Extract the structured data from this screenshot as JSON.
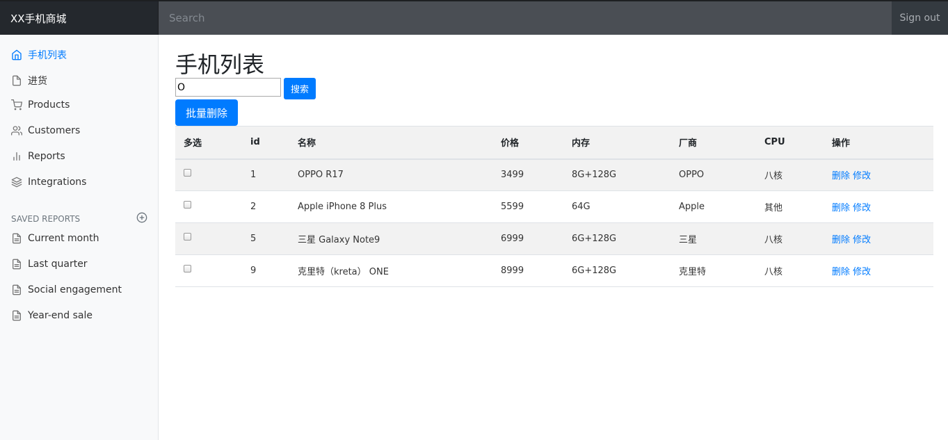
{
  "navbar": {
    "brand": "XX手机商城",
    "search_placeholder": "Search",
    "signout": "Sign out"
  },
  "sidebar": {
    "items": [
      {
        "label": "手机列表",
        "icon": "home-icon",
        "active": true
      },
      {
        "label": "进货",
        "icon": "file-icon"
      },
      {
        "label": "Products",
        "icon": "shopping-cart-icon"
      },
      {
        "label": "Customers",
        "icon": "users-icon"
      },
      {
        "label": "Reports",
        "icon": "bar-chart-icon"
      },
      {
        "label": "Integrations",
        "icon": "layers-icon"
      }
    ],
    "saved_heading": "SAVED REPORTS",
    "saved": [
      {
        "label": "Current month",
        "icon": "file-text-icon"
      },
      {
        "label": "Last quarter",
        "icon": "file-text-icon"
      },
      {
        "label": "Social engagement",
        "icon": "file-text-icon"
      },
      {
        "label": "Year-end sale",
        "icon": "file-text-icon"
      }
    ]
  },
  "main": {
    "title": "手机列表",
    "query_value": "O",
    "search_label": "搜索",
    "bulk_delete_label": "批量删除",
    "table": {
      "headers": [
        "多选",
        "id",
        "名称",
        "价格",
        "内存",
        "厂商",
        "CPU",
        "操作"
      ],
      "rows": [
        {
          "id": "1",
          "name": "OPPO R17",
          "price": "3499",
          "memory": "8G+128G",
          "vendor": "OPPO",
          "cpu": "八核"
        },
        {
          "id": "2",
          "name": "Apple iPhone 8 Plus",
          "price": "5599",
          "memory": "64G",
          "vendor": "Apple",
          "cpu": "其他"
        },
        {
          "id": "5",
          "name": "三星 Galaxy Note9",
          "price": "6999",
          "memory": "6G+128G",
          "vendor": "三星",
          "cpu": "八核"
        },
        {
          "id": "9",
          "name": "克里特（kreta） ONE",
          "price": "8999",
          "memory": "6G+128G",
          "vendor": "克里特",
          "cpu": "八核"
        }
      ],
      "delete_label": "删除",
      "edit_label": "修改"
    }
  },
  "colors": {
    "accent": "#007bff",
    "navbar": "#343a40",
    "sidebar": "#f8f9fa"
  }
}
